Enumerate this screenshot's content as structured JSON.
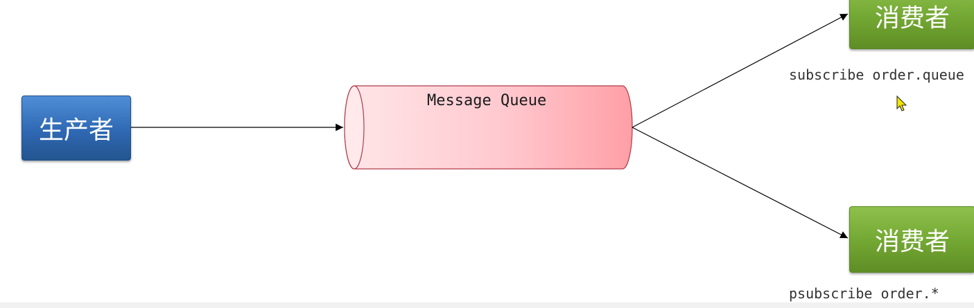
{
  "producer": {
    "label": "生产者"
  },
  "queue": {
    "label": "Message Queue"
  },
  "consumers": [
    {
      "label": "消费者",
      "caption": "subscribe order.queue"
    },
    {
      "label": "消费者",
      "caption": "psubscribe order.*"
    }
  ],
  "colors": {
    "producer": "#2f68b3",
    "consumer": "#72a632",
    "queue_fill": "#ffb3b8",
    "queue_stroke": "#b03a4a"
  }
}
